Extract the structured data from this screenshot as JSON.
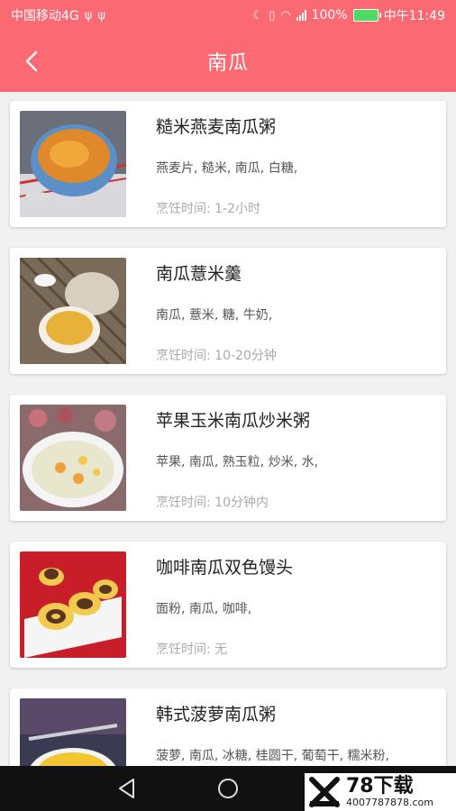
{
  "status_bar": {
    "carrier": "中国移动4G",
    "battery": "100%",
    "time": "中午11:49",
    "network": "4G"
  },
  "header": {
    "title": "南瓜",
    "back_icon": "chevron-left-icon"
  },
  "recipes": [
    {
      "title": "糙米燕麦南瓜粥",
      "ingredients": "燕麦片, 糙米, 南瓜, 白糖,",
      "time": "烹饪时间: 1-2小时"
    },
    {
      "title": "南瓜薏米羹",
      "ingredients": "南瓜, 薏米, 糖, 牛奶,",
      "time": "烹饪时间: 10-20分钟"
    },
    {
      "title": "苹果玉米南瓜炒米粥",
      "ingredients": "苹果, 南瓜, 熟玉粒, 炒米, 水,",
      "time": "烹饪时间: 10分钟内"
    },
    {
      "title": "咖啡南瓜双色馒头",
      "ingredients": "面粉, 南瓜, 咖啡,",
      "time": "烹饪时间: 无"
    },
    {
      "title": "韩式菠萝南瓜粥",
      "ingredients": "菠萝, 南瓜, 冰糖, 桂圆干, 葡萄干, 糯米粉,",
      "time": ""
    }
  ],
  "watermark": {
    "brand": "78下载",
    "phone": "4007787878.com"
  },
  "colors": {
    "accent": "#fb6a73",
    "background": "#f1f1f1"
  }
}
